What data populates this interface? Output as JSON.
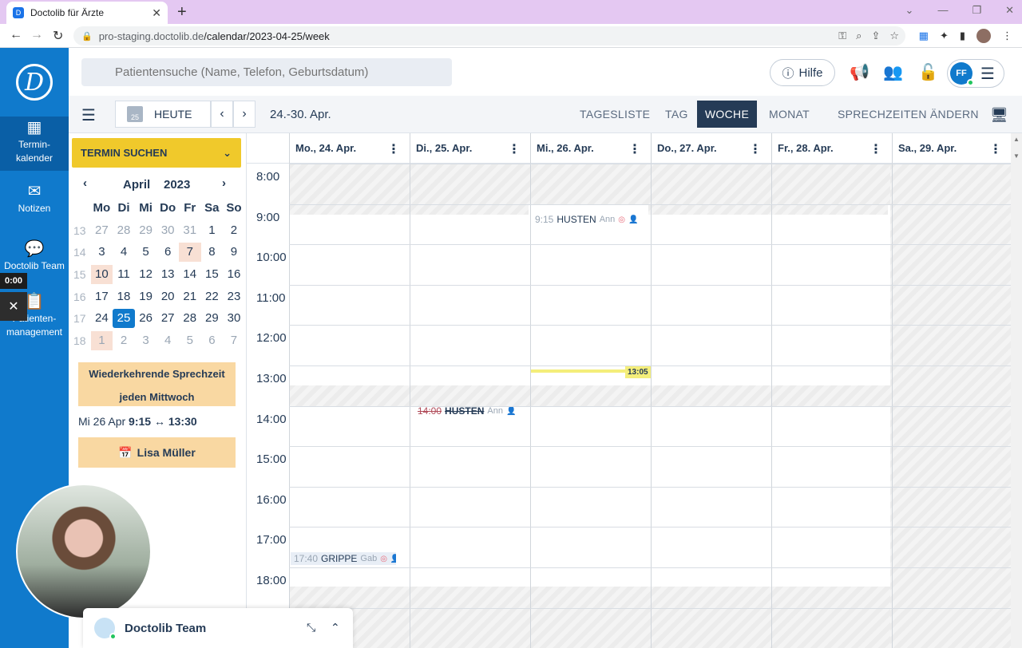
{
  "browser": {
    "tab_title": "Doctolib für Ärzte",
    "url_host": "pro-staging.doctolib.de",
    "url_path": "/calendar/2023-04-25/week"
  },
  "nav": {
    "logo_letter": "D",
    "items": [
      {
        "label": "Termin-",
        "label2": "kalender",
        "icon": "calendar-icon"
      },
      {
        "label": "Notizen",
        "icon": "mail-icon"
      },
      {
        "label": "Doctolib Team",
        "icon": "chat-icon"
      },
      {
        "label": "Patienten-",
        "label2": "management",
        "icon": "clipboard-icon"
      }
    ],
    "timer": "0:00"
  },
  "header": {
    "search_placeholder": "Patientensuche (Name, Telefon, Geburtsdatum)",
    "help_label": "Hilfe",
    "user_initials": "FF"
  },
  "toolbar": {
    "today_label": "HEUTE",
    "today_icon_num": "25",
    "date_range": "24.-30. Apr.",
    "views": [
      "TAGESLISTE",
      "TAG",
      "WOCHE",
      "MONAT",
      "SPRECHZEITEN ÄNDERN"
    ],
    "active_view": "WOCHE"
  },
  "sidebar": {
    "find_label": "TERMIN SUCHEN",
    "month": "April",
    "year": "2023",
    "weekdays": [
      "Mo",
      "Di",
      "Mi",
      "Do",
      "Fr",
      "Sa",
      "So"
    ],
    "weeks": [
      {
        "wk": "13",
        "days": [
          "27",
          "28",
          "29",
          "30",
          "31",
          "1",
          "2"
        ]
      },
      {
        "wk": "14",
        "days": [
          "3",
          "4",
          "5",
          "6",
          "7",
          "8",
          "9"
        ]
      },
      {
        "wk": "15",
        "days": [
          "10",
          "11",
          "12",
          "13",
          "14",
          "15",
          "16"
        ]
      },
      {
        "wk": "16",
        "days": [
          "17",
          "18",
          "19",
          "20",
          "21",
          "22",
          "23"
        ]
      },
      {
        "wk": "17",
        "days": [
          "24",
          "25",
          "26",
          "27",
          "28",
          "29",
          "30"
        ]
      },
      {
        "wk": "18",
        "days": [
          "1",
          "2",
          "3",
          "4",
          "5",
          "6",
          "7"
        ]
      }
    ],
    "recurring_line1": "Wiederkehrende Sprechzeit",
    "recurring_line2": "jeden Mittwoch",
    "recurring_date": "Mi 26 Apr",
    "recurring_start": "9:15",
    "recurring_arrow": "↔",
    "recurring_end": "13:30",
    "doctor": "Lisa Müller"
  },
  "calendar": {
    "days": [
      "Mo., 24. Apr.",
      "Di., 25. Apr.",
      "Mi., 26. Apr.",
      "Do., 27. Apr.",
      "Fr., 28. Apr.",
      "Sa., 29. Apr."
    ],
    "hours": [
      "8:00",
      "9:00",
      "10:00",
      "11:00",
      "12:00",
      "13:00",
      "14:00",
      "15:00",
      "16:00",
      "17:00",
      "18:00"
    ],
    "now": "13:05",
    "appointments": [
      {
        "time": "9:15",
        "title": "HUSTEN",
        "patient": "Ann",
        "day": 2
      },
      {
        "time": "14:00",
        "title": "HUSTEN",
        "patient": "Ann",
        "day": 1,
        "cancelled": true
      },
      {
        "time": "17:40",
        "title": "GRIPPE",
        "patient": "Gab",
        "day": 0
      }
    ]
  },
  "team": {
    "name": "Doctolib Team"
  }
}
